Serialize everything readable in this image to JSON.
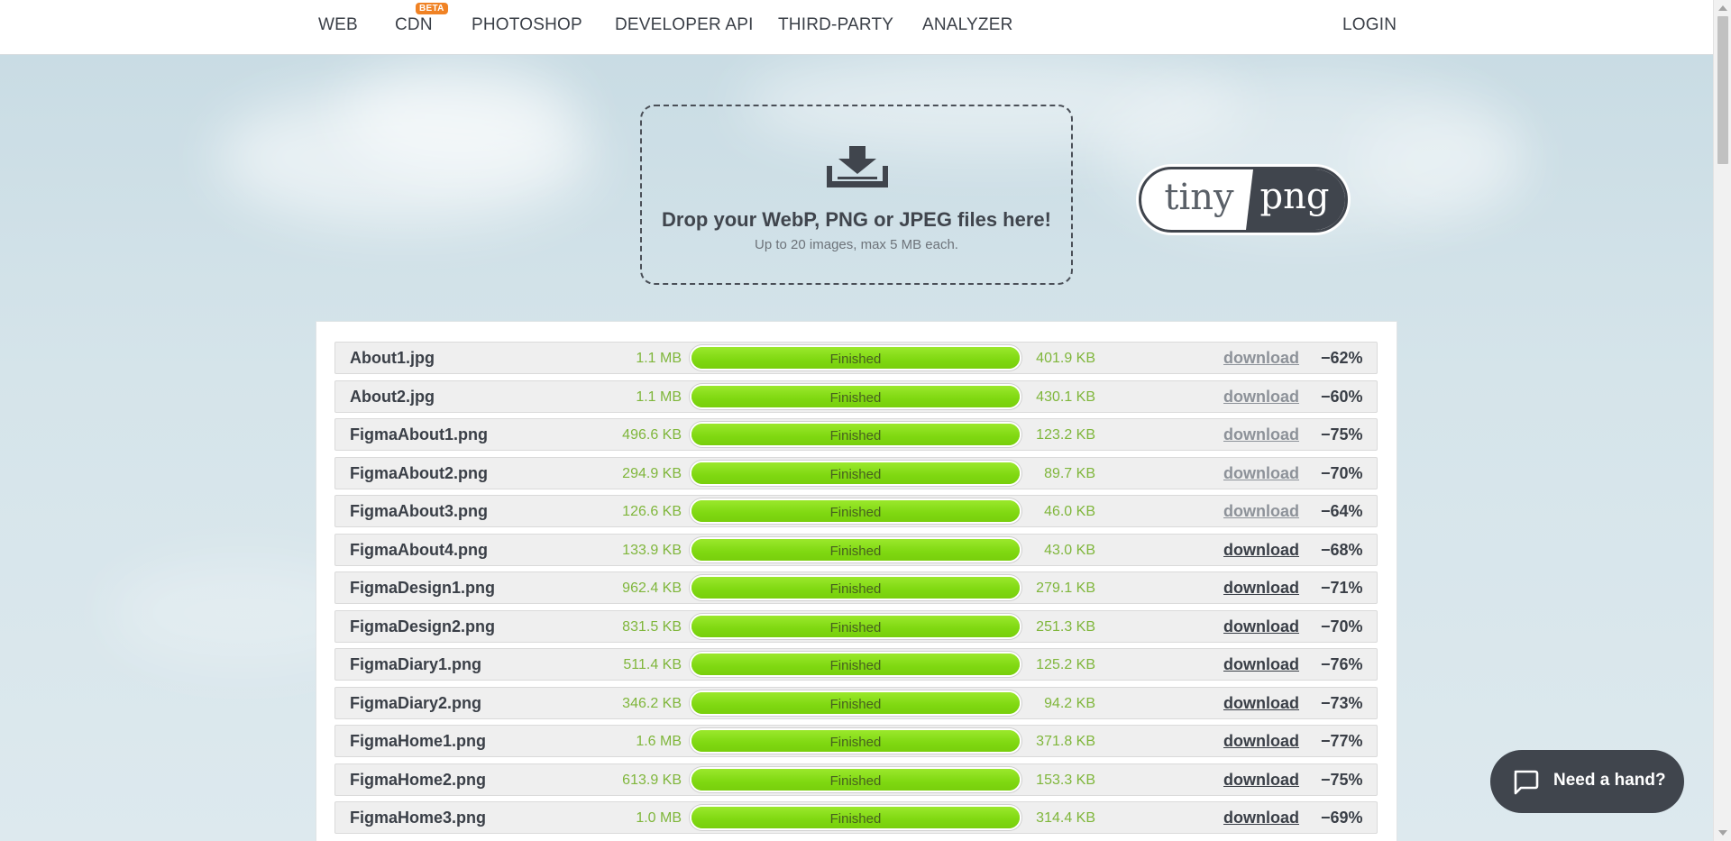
{
  "nav": {
    "items": [
      {
        "label": "WEB"
      },
      {
        "label": "CDN"
      },
      {
        "label": "PHOTOSHOP"
      },
      {
        "label": "DEVELOPER API"
      },
      {
        "label": "THIRD-PARTY"
      },
      {
        "label": "ANALYZER"
      }
    ],
    "cdn_badge": "BETA",
    "login": "LOGIN"
  },
  "dropzone": {
    "title": "Drop your WebP, PNG or JPEG files here!",
    "subtitle": "Up to 20 images, max 5 MB each."
  },
  "logo": {
    "left": "tiny",
    "right": "png"
  },
  "files": [
    {
      "name": "About1.jpg",
      "original": "1.1 MB",
      "status": "Finished",
      "progress": 1.0,
      "compressed": "401.9 KB",
      "download": "download",
      "visited": true,
      "savings": "−62%"
    },
    {
      "name": "About2.jpg",
      "original": "1.1 MB",
      "status": "Finished",
      "progress": 1.0,
      "compressed": "430.1 KB",
      "download": "download",
      "visited": true,
      "savings": "−60%"
    },
    {
      "name": "FigmaAbout1.png",
      "original": "496.6 KB",
      "status": "Finished",
      "progress": 1.0,
      "compressed": "123.2 KB",
      "download": "download",
      "visited": true,
      "savings": "−75%"
    },
    {
      "name": "FigmaAbout2.png",
      "original": "294.9 KB",
      "status": "Finished",
      "progress": 1.0,
      "compressed": "89.7 KB",
      "download": "download",
      "visited": true,
      "savings": "−70%"
    },
    {
      "name": "FigmaAbout3.png",
      "original": "126.6 KB",
      "status": "Finished",
      "progress": 1.0,
      "compressed": "46.0 KB",
      "download": "download",
      "visited": true,
      "savings": "−64%"
    },
    {
      "name": "FigmaAbout4.png",
      "original": "133.9 KB",
      "status": "Finished",
      "progress": 1.0,
      "compressed": "43.0 KB",
      "download": "download",
      "visited": false,
      "savings": "−68%"
    },
    {
      "name": "FigmaDesign1.png",
      "original": "962.4 KB",
      "status": "Finished",
      "progress": 1.0,
      "compressed": "279.1 KB",
      "download": "download",
      "visited": false,
      "savings": "−71%"
    },
    {
      "name": "FigmaDesign2.png",
      "original": "831.5 KB",
      "status": "Finished",
      "progress": 1.0,
      "compressed": "251.3 KB",
      "download": "download",
      "visited": false,
      "savings": "−70%"
    },
    {
      "name": "FigmaDiary1.png",
      "original": "511.4 KB",
      "status": "Finished",
      "progress": 1.0,
      "compressed": "125.2 KB",
      "download": "download",
      "visited": false,
      "savings": "−76%"
    },
    {
      "name": "FigmaDiary2.png",
      "original": "346.2 KB",
      "status": "Finished",
      "progress": 1.0,
      "compressed": "94.2 KB",
      "download": "download",
      "visited": false,
      "savings": "−73%"
    },
    {
      "name": "FigmaHome1.png",
      "original": "1.6 MB",
      "status": "Finished",
      "progress": 1.0,
      "compressed": "371.8 KB",
      "download": "download",
      "visited": false,
      "savings": "−77%"
    },
    {
      "name": "FigmaHome2.png",
      "original": "613.9 KB",
      "status": "Finished",
      "progress": 1.0,
      "compressed": "153.3 KB",
      "download": "download",
      "visited": false,
      "savings": "−75%"
    },
    {
      "name": "FigmaHome3.png",
      "original": "1.0 MB",
      "status": "Finished",
      "progress": 1.0,
      "compressed": "314.4 KB",
      "download": "download",
      "visited": false,
      "savings": "−69%"
    }
  ],
  "help": {
    "label": "Need a hand?",
    "icon": "chat-bubble-icon"
  },
  "colors": {
    "accent_green": "#82e012",
    "dark": "#40454d",
    "beta_orange": "#f08224"
  }
}
